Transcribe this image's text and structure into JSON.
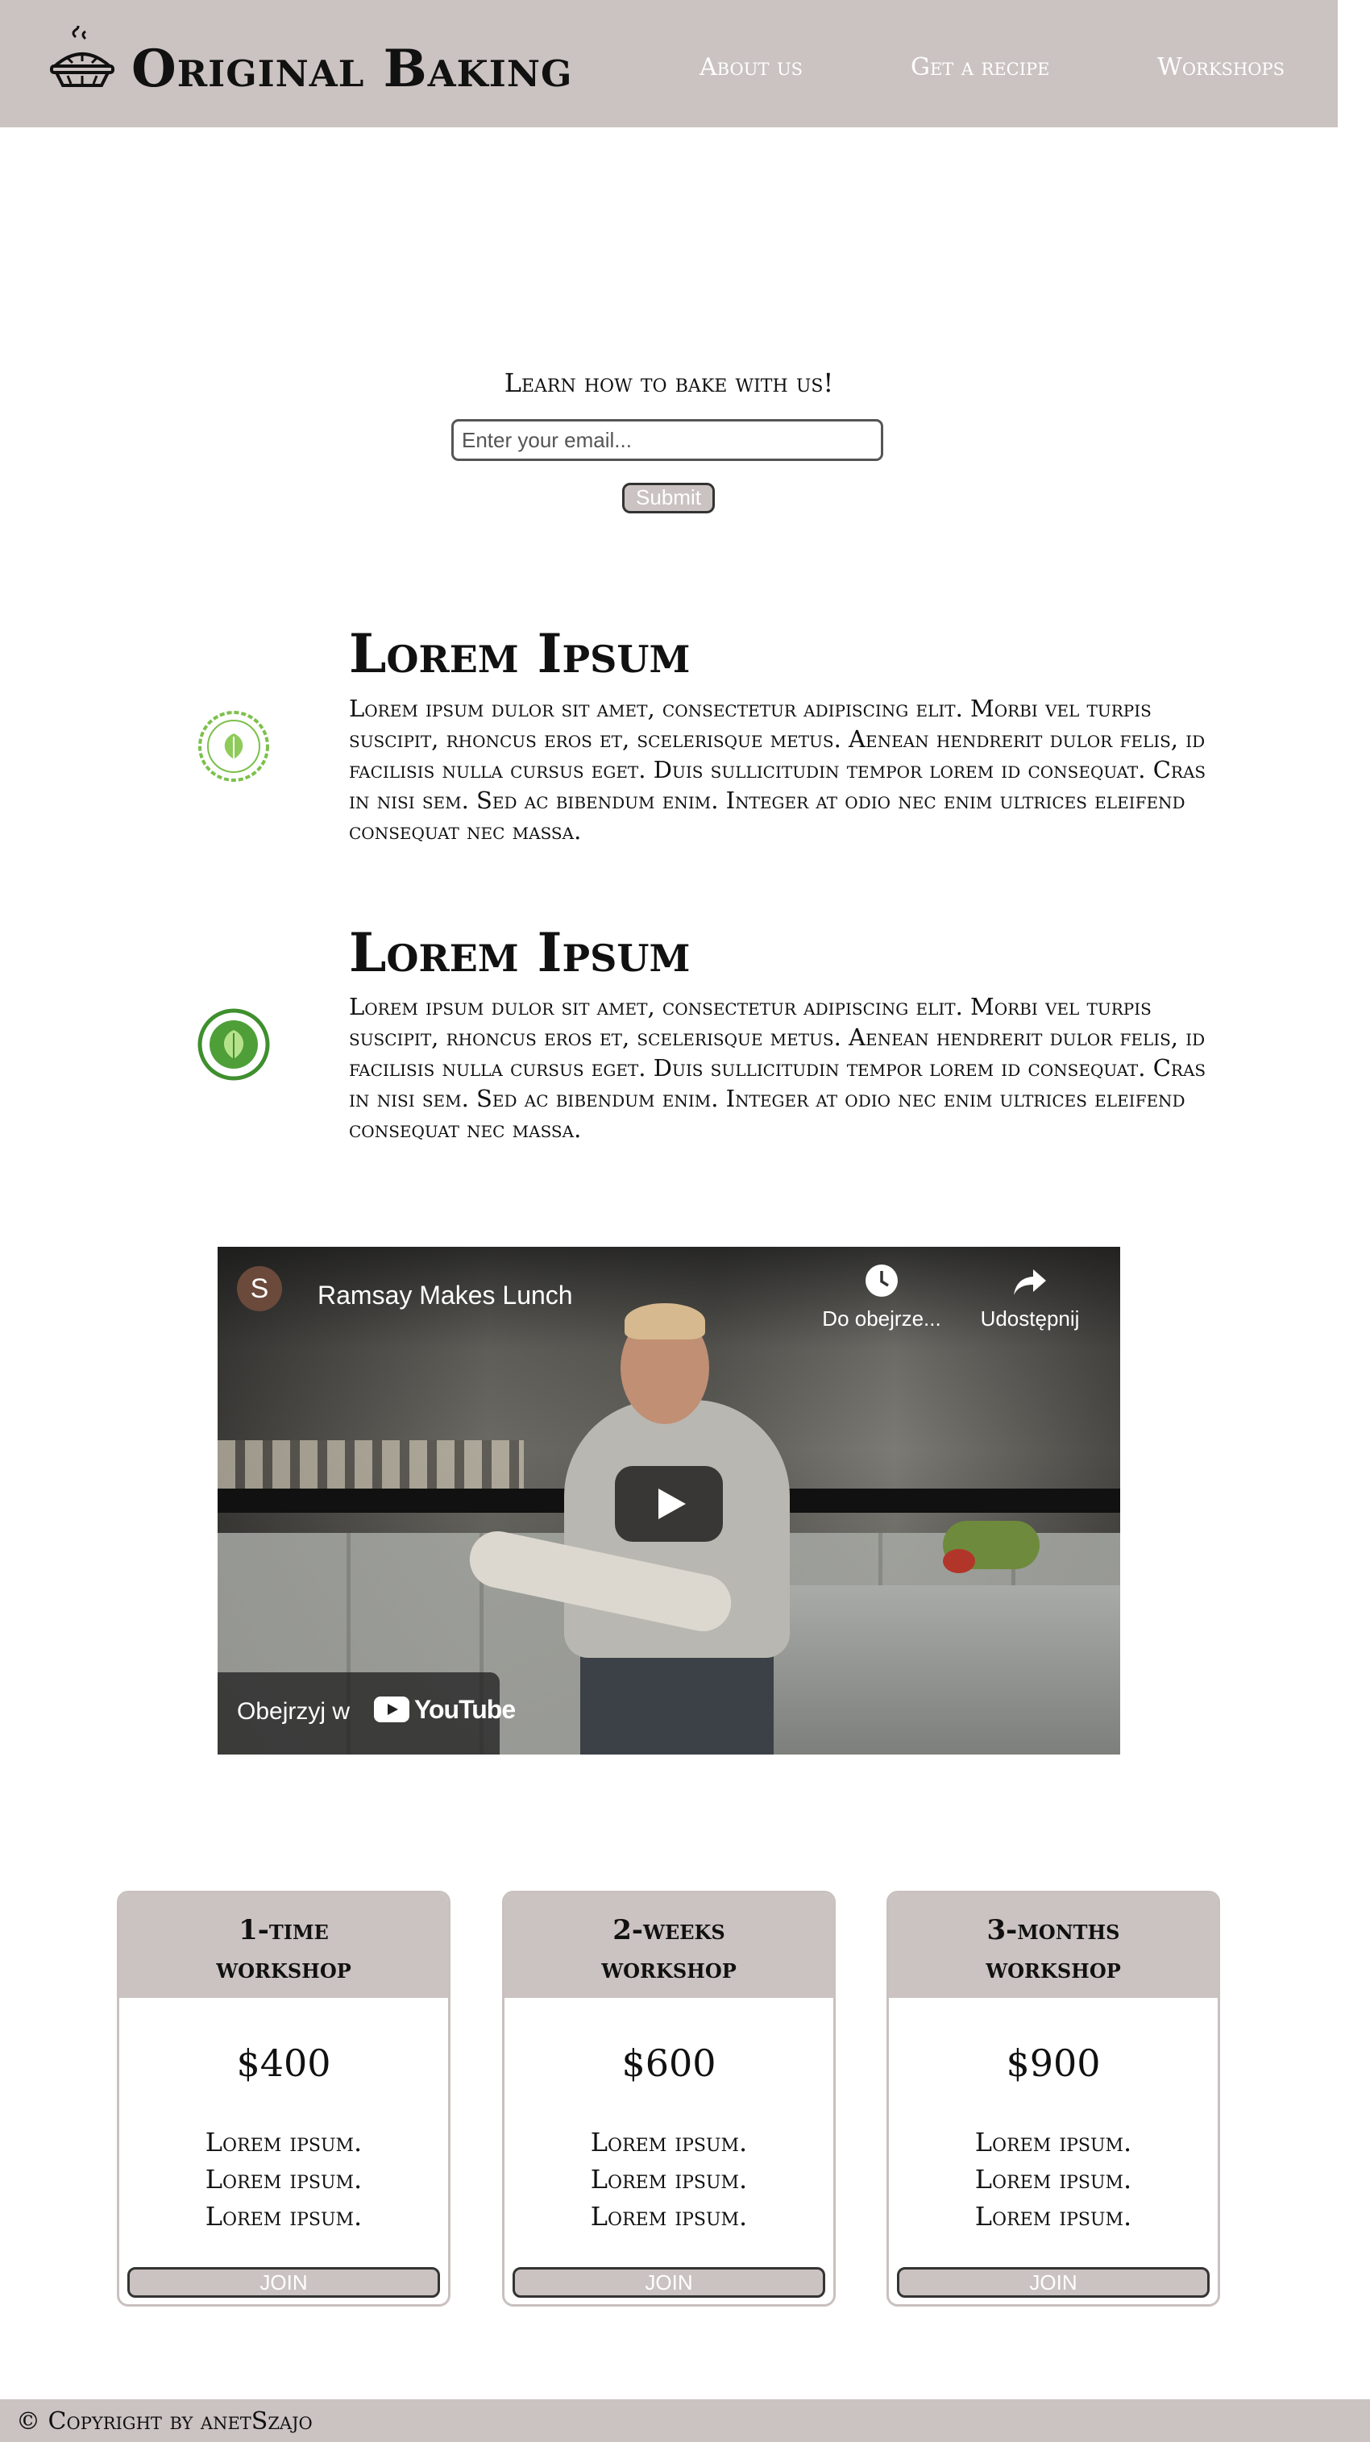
{
  "header": {
    "brand": "Original Baking",
    "nav": [
      {
        "label": "About us"
      },
      {
        "label": "Get a recipe"
      },
      {
        "label": "Workshops"
      }
    ]
  },
  "signup": {
    "heading": "Learn how to bake with us!",
    "email_placeholder": "Enter your email...",
    "email_value": "",
    "submit_label": "Submit"
  },
  "features": [
    {
      "badge_icon": "organic-badge-icon",
      "title": "Lorem Ipsum",
      "text": "Lorem ipsum dulor sit amet, consectetur adipiscing elit. Morbi vel turpis suscipit, rhoncus eros et, scelerisque metus. Aenean hendrerit dulor felis, id facilisis nulla cursus eget. Duis sullicitudin tempor lorem id consequat. Cras in nisi sem. Sed ac bibendum enim. Integer at odio nec enim ultrices eleifend consequat nec massa."
    },
    {
      "badge_icon": "natural-ingredients-badge-icon",
      "title": "Lorem Ipsum",
      "text": "Lorem ipsum dulor sit amet, consectetur adipiscing elit. Morbi vel turpis suscipit, rhoncus eros et, scelerisque metus. Aenean hendrerit dulor felis, id facilisis nulla cursus eget. Duis sullicitudin tempor lorem id consequat. Cras in nisi sem. Sed ac bibendum enim. Integer at odio nec enim ultrices eleifend consequat nec massa."
    }
  ],
  "video": {
    "channel_initial": "S",
    "title": "Ramsay Makes Lunch",
    "watch_later_label": "Do obejrze...",
    "share_label": "Udostępnij",
    "watch_on_label": "Obejrzyj w",
    "platform": "YouTube"
  },
  "pricing": [
    {
      "title": "1-time workshop",
      "price": "$400",
      "features": [
        "Lorem ipsum.",
        "Lorem ipsum.",
        "Lorem ipsum."
      ],
      "button_label": "JOIN"
    },
    {
      "title": "2-weeks workshop",
      "price": "$600",
      "features": [
        "Lorem ipsum.",
        "Lorem ipsum.",
        "Lorem ipsum."
      ],
      "button_label": "JOIN"
    },
    {
      "title": "3-months workshop",
      "price": "$900",
      "features": [
        "Lorem ipsum.",
        "Lorem ipsum.",
        "Lorem ipsum."
      ],
      "button_label": "JOIN"
    }
  ],
  "footer": {
    "text": "© Copyright by anetSzajo"
  },
  "colors": {
    "header_bg": "#cbc3c1",
    "badge_green": "#6bb33a",
    "text": "#111111"
  }
}
